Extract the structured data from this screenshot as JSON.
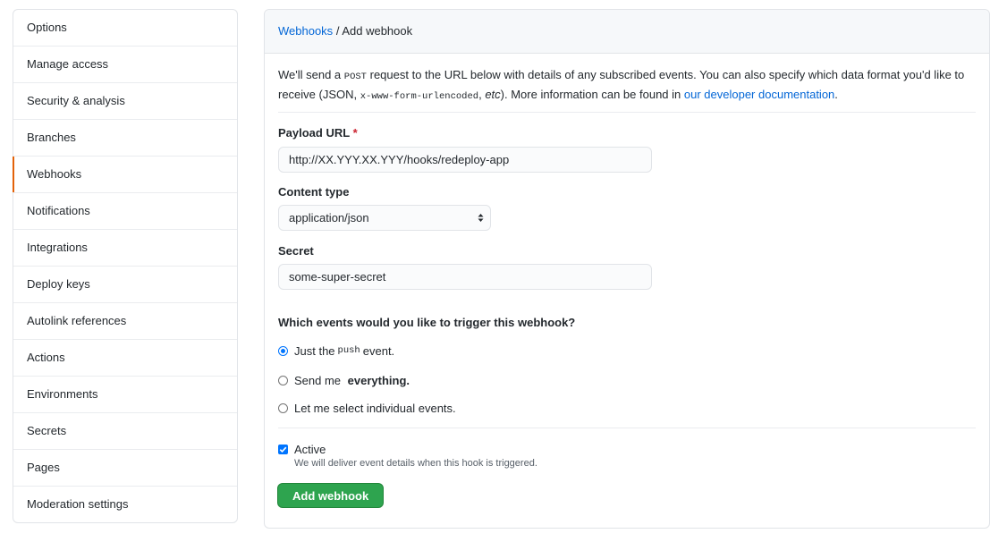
{
  "sidebar": {
    "items": [
      {
        "label": "Options"
      },
      {
        "label": "Manage access"
      },
      {
        "label": "Security & analysis"
      },
      {
        "label": "Branches"
      },
      {
        "label": "Webhooks"
      },
      {
        "label": "Notifications"
      },
      {
        "label": "Integrations"
      },
      {
        "label": "Deploy keys"
      },
      {
        "label": "Autolink references"
      },
      {
        "label": "Actions"
      },
      {
        "label": "Environments"
      },
      {
        "label": "Secrets"
      },
      {
        "label": "Pages"
      },
      {
        "label": "Moderation settings"
      }
    ],
    "selected": "Webhooks",
    "accent_color": "#e36209"
  },
  "breadcrumb": {
    "parent": "Webhooks",
    "separator": "/",
    "current": "Add webhook"
  },
  "intro": {
    "part1": "We'll send a ",
    "method": "POST",
    "part2": " request to the URL below with details of any subscribed events. You can also specify which data format you'd like to receive (JSON, ",
    "format": "x-www-form-urlencoded",
    "part3": ", ",
    "etc": "etc",
    "part4": "). More information can be found in ",
    "link": "our developer documentation",
    "part5": "."
  },
  "form": {
    "payload_url": {
      "label": "Payload URL",
      "required_marker": "*",
      "value": "http://XX.YYY.XX.YYY/hooks/redeploy-app"
    },
    "content_type": {
      "label": "Content type",
      "value": "application/json"
    },
    "secret": {
      "label": "Secret",
      "value": "some-super-secret"
    }
  },
  "events": {
    "question": "Which events would you like to trigger this webhook?",
    "option_push_prefix": "Just the ",
    "option_push_code": "push",
    "option_push_suffix": " event.",
    "option_all_prefix": "Send me ",
    "option_all_bold": "everything.",
    "option_select": "Let me select individual events.",
    "selected": "push"
  },
  "active": {
    "label": "Active",
    "checked": true,
    "note": "We will deliver event details when this hook is triggered."
  },
  "submit": {
    "label": "Add webhook",
    "color": "#2ea44f"
  },
  "colors": {
    "link": "#0366d6",
    "required": "#cb2431",
    "control_accent": "#0075ff"
  }
}
